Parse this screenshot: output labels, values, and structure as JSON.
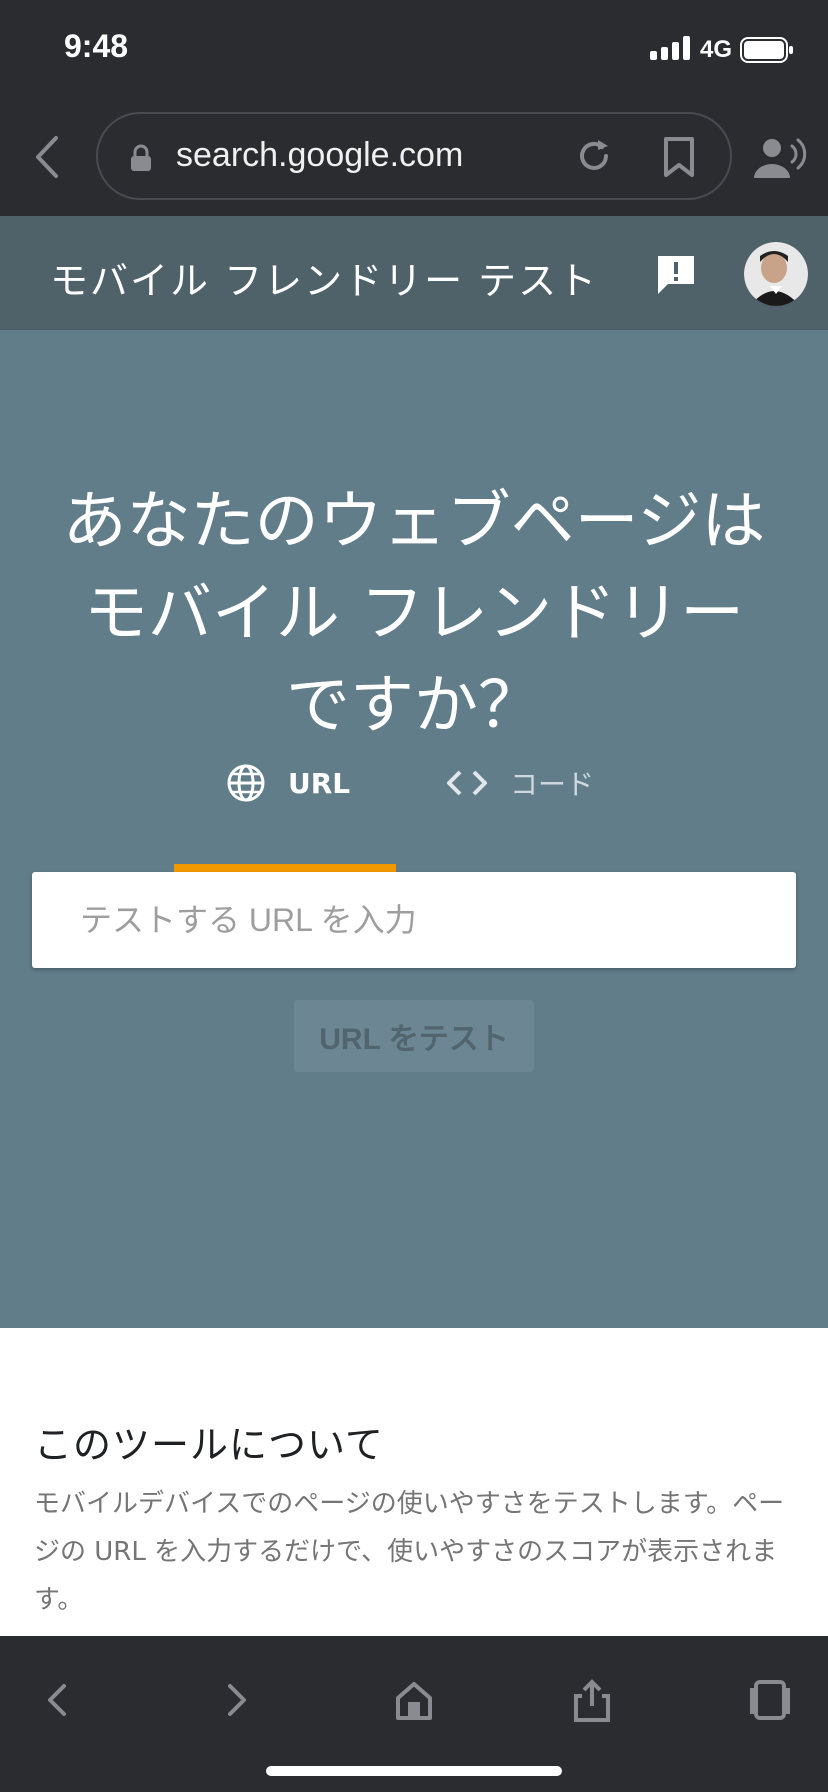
{
  "status_bar": {
    "time": "9:48",
    "network": "4G"
  },
  "browser": {
    "url": "search.google.com",
    "icons": [
      "back-chevron-icon",
      "lock-icon",
      "reload-icon",
      "bookmark-icon",
      "speaker-icon"
    ]
  },
  "app": {
    "title": "モバイル フレンドリー テスト"
  },
  "hero": {
    "title_line1": "あなたのウェブページは",
    "title_line2": "モバイル フレンドリー",
    "title_line3": "ですか？",
    "tabs": [
      {
        "label": "URL",
        "icon": "globe-icon",
        "active": true
      },
      {
        "label": "コード",
        "icon": "code-icon",
        "active": false
      }
    ],
    "input_placeholder": "テストする URL を入力",
    "button_label": "URL をテスト"
  },
  "about": {
    "title": "このツールについて",
    "body": "モバイルデバイスでのページの使いやすさをテストします。ページの URL を入力するだけで、使いやすさのスコアが表示されます。"
  },
  "colors": {
    "browser_chrome": "#2b2c30",
    "app_header": "#4f6169",
    "hero_bg": "#627d8a",
    "tab_accent": "#f29900",
    "about_bg": "#ffffff"
  },
  "toolbar": {
    "icons": [
      "back-icon",
      "forward-icon",
      "home-icon",
      "share-icon",
      "tabs-icon"
    ]
  }
}
